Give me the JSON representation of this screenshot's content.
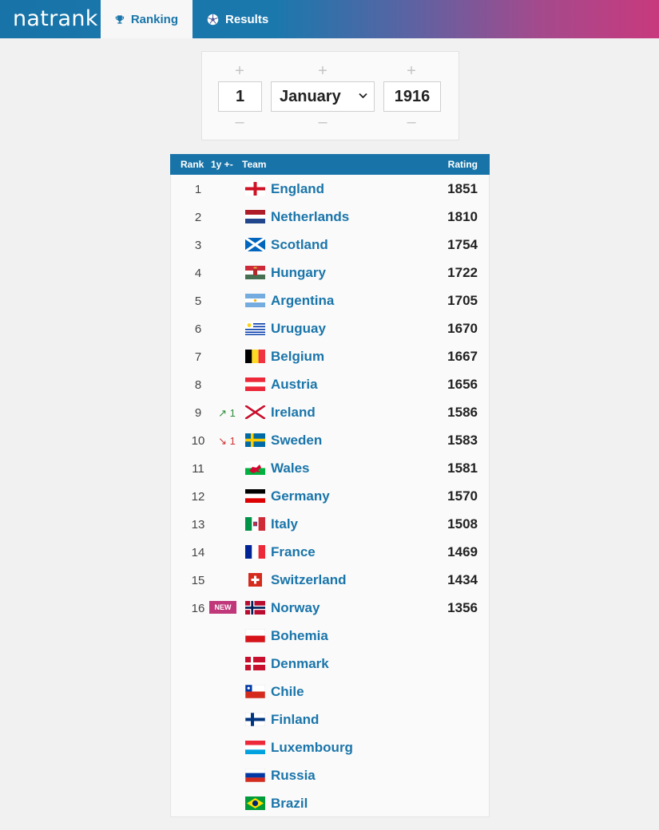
{
  "nav": {
    "logo": "natrank",
    "tabs": [
      {
        "label": "Ranking",
        "icon": "trophy-icon",
        "active": true
      },
      {
        "label": "Results",
        "icon": "soccer-ball-icon",
        "active": false
      }
    ]
  },
  "date": {
    "plus": "+",
    "minus": "–",
    "day": "1",
    "month": "January",
    "year": "1916"
  },
  "table": {
    "headers": {
      "rank": "Rank",
      "change": "1y +-",
      "team": "Team",
      "rating": "Rating"
    },
    "rows": [
      {
        "rank": "1",
        "change": "",
        "team": "England",
        "rating": "1851",
        "flag": "england"
      },
      {
        "rank": "2",
        "change": "",
        "team": "Netherlands",
        "rating": "1810",
        "flag": "netherlands"
      },
      {
        "rank": "3",
        "change": "",
        "team": "Scotland",
        "rating": "1754",
        "flag": "scotland"
      },
      {
        "rank": "4",
        "change": "",
        "team": "Hungary",
        "rating": "1722",
        "flag": "hungary"
      },
      {
        "rank": "5",
        "change": "",
        "team": "Argentina",
        "rating": "1705",
        "flag": "argentina"
      },
      {
        "rank": "6",
        "change": "",
        "team": "Uruguay",
        "rating": "1670",
        "flag": "uruguay"
      },
      {
        "rank": "7",
        "change": "",
        "team": "Belgium",
        "rating": "1667",
        "flag": "belgium"
      },
      {
        "rank": "8",
        "change": "",
        "team": "Austria",
        "rating": "1656",
        "flag": "austria"
      },
      {
        "rank": "9",
        "change": "↗ 1",
        "change_dir": "up",
        "team": "Ireland",
        "rating": "1586",
        "flag": "ireland"
      },
      {
        "rank": "10",
        "change": "↘ 1",
        "change_dir": "down",
        "team": "Sweden",
        "rating": "1583",
        "flag": "sweden"
      },
      {
        "rank": "11",
        "change": "",
        "team": "Wales",
        "rating": "1581",
        "flag": "wales"
      },
      {
        "rank": "12",
        "change": "",
        "team": "Germany",
        "rating": "1570",
        "flag": "germany"
      },
      {
        "rank": "13",
        "change": "",
        "team": "Italy",
        "rating": "1508",
        "flag": "italy"
      },
      {
        "rank": "14",
        "change": "",
        "team": "France",
        "rating": "1469",
        "flag": "france"
      },
      {
        "rank": "15",
        "change": "",
        "team": "Switzerland",
        "rating": "1434",
        "flag": "switzerland"
      },
      {
        "rank": "16",
        "change": "NEW",
        "change_dir": "new",
        "team": "Norway",
        "rating": "1356",
        "flag": "norway"
      },
      {
        "rank": "",
        "change": "",
        "team": "Bohemia",
        "rating": "",
        "flag": "bohemia"
      },
      {
        "rank": "",
        "change": "",
        "team": "Denmark",
        "rating": "",
        "flag": "denmark"
      },
      {
        "rank": "",
        "change": "",
        "team": "Chile",
        "rating": "",
        "flag": "chile"
      },
      {
        "rank": "",
        "change": "",
        "team": "Finland",
        "rating": "",
        "flag": "finland"
      },
      {
        "rank": "",
        "change": "",
        "team": "Luxembourg",
        "rating": "",
        "flag": "luxembourg"
      },
      {
        "rank": "",
        "change": "",
        "team": "Russia",
        "rating": "",
        "flag": "russia"
      },
      {
        "rank": "",
        "change": "",
        "team": "Brazil",
        "rating": "",
        "flag": "brazil"
      }
    ]
  },
  "colors": {
    "brand_blue": "#1874a8",
    "brand_pink": "#c8397d",
    "link": "#1a75aa",
    "up": "#2e8b3a",
    "down": "#cc3333",
    "new_badge": "#c0387a"
  }
}
